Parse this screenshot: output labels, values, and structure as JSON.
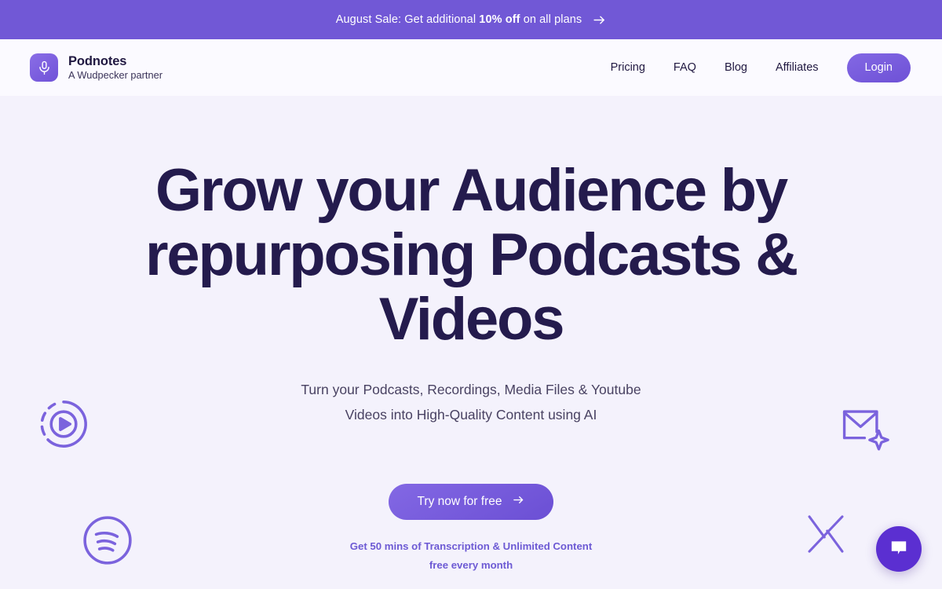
{
  "announcement": {
    "prefix": "August Sale: Get additional ",
    "highlight": "10% off",
    "suffix": " on all plans",
    "arrow_icon": "arrow-right-icon",
    "background": "#7158d6",
    "text_color": "#ffffff"
  },
  "header": {
    "brand": {
      "name": "Podnotes",
      "tagline": "A Wudpecker partner",
      "logo_icon": "microphone-icon",
      "logo_background": "#7052d8"
    },
    "nav": [
      {
        "label": "Pricing"
      },
      {
        "label": "FAQ"
      },
      {
        "label": "Blog"
      },
      {
        "label": "Affiliates"
      }
    ],
    "login_label": "Login",
    "login_color": "#7052d8",
    "background": "#fbfaff"
  },
  "hero": {
    "headline_line1": "Grow your Audience by",
    "headline_line2": "repurposing Podcasts & Videos",
    "headline_color": "#241b4d",
    "subhead_line1": "Turn your Podcasts, Recordings, Media Files & Youtube",
    "subhead_line2": "Videos into High-Quality Content using AI",
    "subhead_color": "#494262",
    "cta_label": "Try now for free",
    "cta_arrow_icon": "arrow-right-icon",
    "cta_background": "#6b4fd4",
    "cta_note_line1": "Get 50 mins of Transcription & Unlimited Content",
    "cta_note_line2": "free every month",
    "cta_note_color": "#6d5ad4",
    "background": "#f4f2fc",
    "decorations": [
      {
        "icon": "play-circle-icon",
        "position": "left-upper"
      },
      {
        "icon": "mail-sparkle-icon",
        "position": "right-upper"
      },
      {
        "icon": "spotify-icon",
        "position": "left-lower"
      },
      {
        "icon": "x-twitter-icon",
        "position": "right-lower"
      }
    ],
    "decoration_color": "#7b63dd"
  },
  "chat_widget": {
    "icon": "chat-bubble-icon",
    "background": "#5b2fd1"
  }
}
